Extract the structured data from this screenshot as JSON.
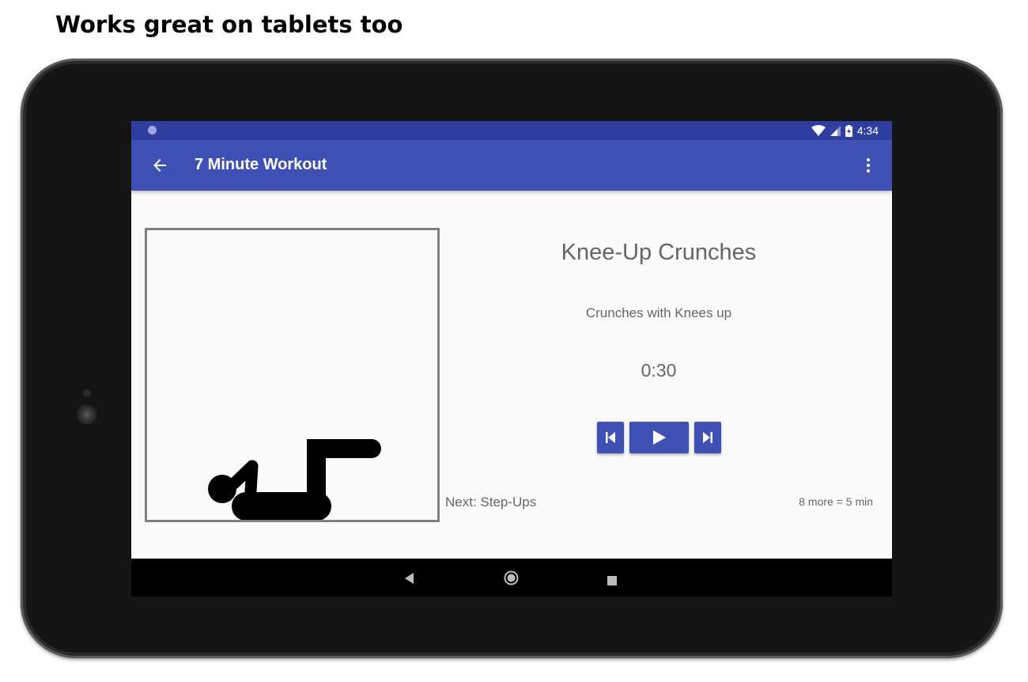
{
  "headline": "Works great on tablets too",
  "status_bar": {
    "time": "4:34",
    "icons": [
      "notification-dot-icon",
      "wifi-icon",
      "signal-icon",
      "battery-charging-icon"
    ]
  },
  "app_bar": {
    "title": "7 Minute Workout",
    "back_icon": "arrow-back-icon",
    "overflow_icon": "more-vert-icon"
  },
  "exercise": {
    "title": "Knee-Up Crunches",
    "description": "Crunches with Knees up",
    "timer": "0:30",
    "next": "Next: Step-Ups",
    "remaining": "8 more = 5 min"
  },
  "controls": {
    "previous_icon": "skip-previous-icon",
    "play_icon": "play-icon",
    "next_icon": "skip-next-icon"
  },
  "nav_bar": {
    "icons": [
      "back-triangle-icon",
      "home-circle-icon",
      "recents-square-icon"
    ]
  },
  "colors": {
    "primary": "#3f51b5",
    "primary_dark": "#303f9f",
    "text_secondary": "#666666",
    "background": "#fafafa",
    "frame": "#808080"
  }
}
